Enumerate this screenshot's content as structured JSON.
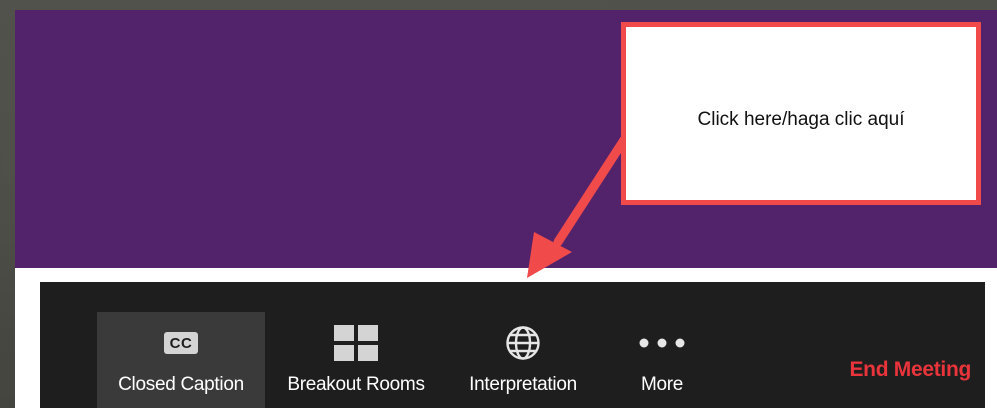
{
  "toolbar": {
    "items": [
      {
        "label": "Closed Caption",
        "icon": "cc-icon",
        "icon_text": "CC",
        "active": true
      },
      {
        "label": "Breakout Rooms",
        "icon": "grid-icon"
      },
      {
        "label": "Interpretation",
        "icon": "globe-icon"
      },
      {
        "label": "More",
        "icon": "ellipsis-icon"
      }
    ],
    "end_meeting_label": "End Meeting"
  },
  "callout": {
    "text": "Click here/haga clic aquí"
  },
  "colors": {
    "purple": "#52236b",
    "toolbar_bg": "#1e1e1e",
    "end_meeting": "#e8343a",
    "callout_border": "#f04a4a"
  }
}
